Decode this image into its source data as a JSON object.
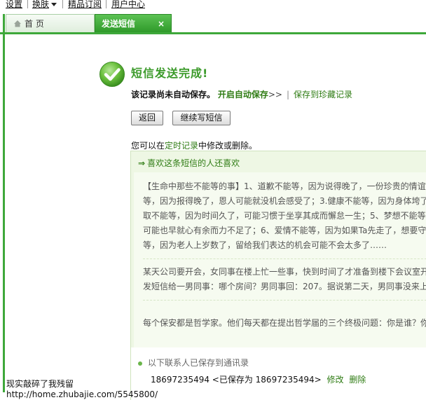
{
  "top_menu": {
    "items": [
      {
        "label": "设置"
      },
      {
        "label": "换肤"
      },
      {
        "label": "精品订阅"
      },
      {
        "label": "用户中心"
      }
    ]
  },
  "tabs": {
    "home": {
      "label": "首 页",
      "icon": "house-icon"
    },
    "send_sms": {
      "label": "发送短信",
      "close": "×"
    }
  },
  "result": {
    "icon": "checkmark-icon",
    "title": "短信发送完成!",
    "not_saved": "该记录尚未自动保存。",
    "enable_auto_save": "开启自动保存",
    "arrows": ">>",
    "pipe": "|",
    "save_to_favorites": "保存到珍藏记录"
  },
  "buttons": {
    "back": "返回",
    "continue_writing": "继续写短信"
  },
  "edit_note": {
    "prefix": "您可以在",
    "keyword": "定时记录",
    "suffix": "中修改或删除。"
  },
  "recommendations": {
    "arrow": "⇒",
    "heading": "喜欢这条短信的人还喜欢",
    "item1": [
      "【生命中那些不能等的事】1、道歉不能等，因为说得晚了，一份珍贵的情谊",
      "等，因为报得晚了，恩人可能就没机会感受了；3.健康不能等，因为身体垮了",
      "取不能等，因为时间久了，可能习惯于坐享其成而懈怠一生；5、梦想不能等",
      "可能也早就心有余而力不足了；6、爱情不能等，因为如果Ta先走了，想要守",
      "等，因为老人上岁数了，留给我们表达的机会可能不会太多了……"
    ],
    "item2": [
      "某天公司要开会，女同事在楼上忙一些事，快到时间了才准备到楼下会议室开",
      "发短信给一男同事：哪个房间？男同事回：207。据说第二天，男同事没来上"
    ],
    "item3": [
      "每个保安都是哲学家。他们每天都在提出哲学届的三个终极问题：你是谁？你"
    ]
  },
  "contacts": {
    "heading": "以下联系人已保存到通讯录",
    "entry": "18697235494 <已保存为 18697235494>",
    "edit": "修改",
    "delete": "删除"
  },
  "watermark": {
    "line1": "现实敲碎了我残留",
    "line2": "http://home.zhubajie.com/5545800/"
  },
  "colors": {
    "accent_green": "#3ea83a",
    "title_green": "#3b9a2a",
    "panel_bg": "#eef7e4"
  }
}
